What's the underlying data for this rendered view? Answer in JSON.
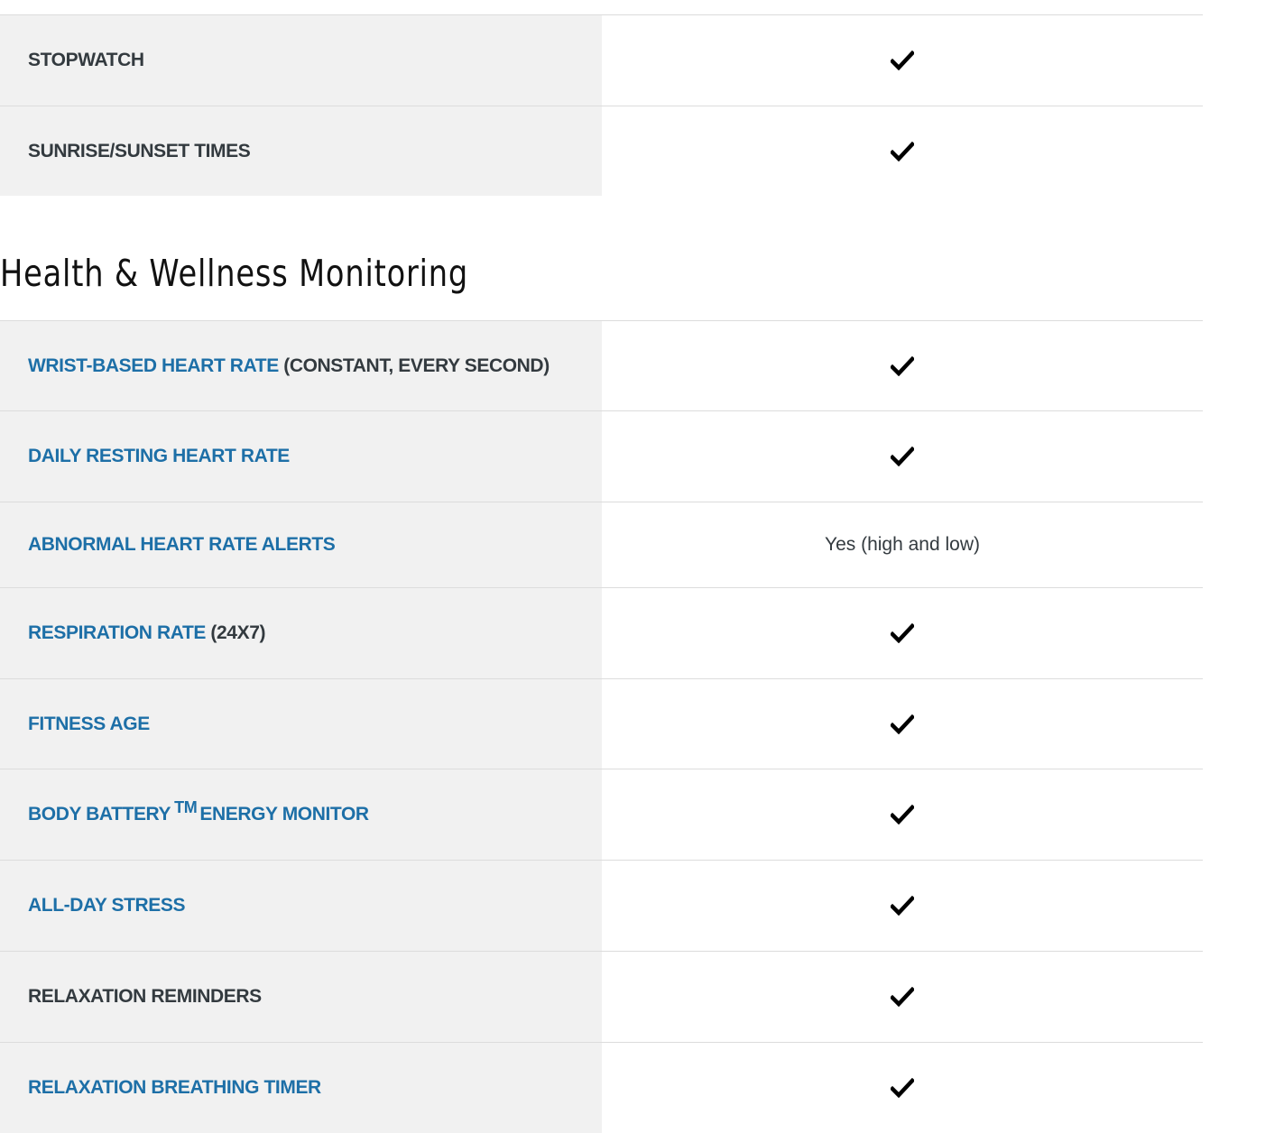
{
  "top_rows": [
    {
      "label": "STOPWATCH",
      "value": "check-icon"
    },
    {
      "label": "SUNRISE/SUNSET TIMES",
      "value": "check-icon"
    }
  ],
  "section": {
    "heading": "Health & Wellness Monitoring"
  },
  "health_rows": {
    "wrist_hr": {
      "link": "WRIST-BASED HEART RATE",
      "suffix": " (CONSTANT, EVERY SECOND)"
    },
    "resting_hr": {
      "link": "DAILY RESTING HEART RATE"
    },
    "abnormal_hr": {
      "link": "ABNORMAL HEART RATE ALERTS",
      "value": "Yes (high and low)"
    },
    "respiration": {
      "link": "RESPIRATION RATE",
      "suffix": " (24X7)"
    },
    "fitness_age": {
      "link": "FITNESS AGE"
    },
    "body_battery": {
      "link_a": "BODY BATTERY",
      "tm": "TM",
      "link_b": "ENERGY MONITOR"
    },
    "stress": {
      "link": "ALL-DAY STRESS"
    },
    "relax_reminders": {
      "label": "RELAXATION REMINDERS"
    },
    "breathing_timer": {
      "link": "RELAXATION BREATHING TIMER"
    }
  },
  "colors": {
    "link": "#1d6fa7",
    "label_bg": "#f1f1f1",
    "text": "#333a3f"
  },
  "icons": {
    "check": "check-icon"
  }
}
